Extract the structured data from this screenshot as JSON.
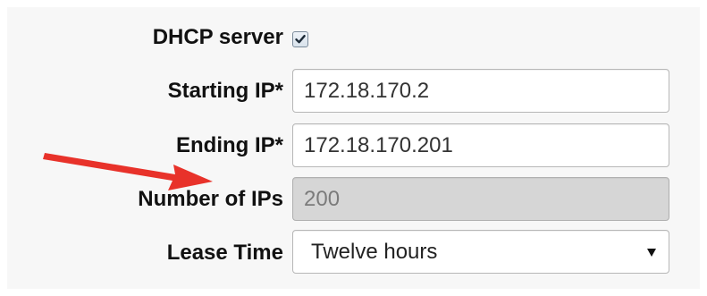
{
  "dhcp_server": {
    "label": "DHCP server",
    "checked": true
  },
  "starting_ip": {
    "label": "Starting IP*",
    "value": "172.18.170.2"
  },
  "ending_ip": {
    "label": "Ending IP*",
    "value": "172.18.170.201"
  },
  "number_of_ips": {
    "label": "Number of IPs",
    "value": "200"
  },
  "lease_time": {
    "label": "Lease Time",
    "selected": "Twelve hours"
  },
  "colors": {
    "panel_bg": "#f7f7f7",
    "readonly_bg": "#d6d6d6",
    "annotation_arrow": "#e8322a"
  },
  "icons": {
    "checkbox_mark": "checkmark-icon",
    "select_caret": "caret-down-icon",
    "annotation": "red-arrow-annotation"
  }
}
